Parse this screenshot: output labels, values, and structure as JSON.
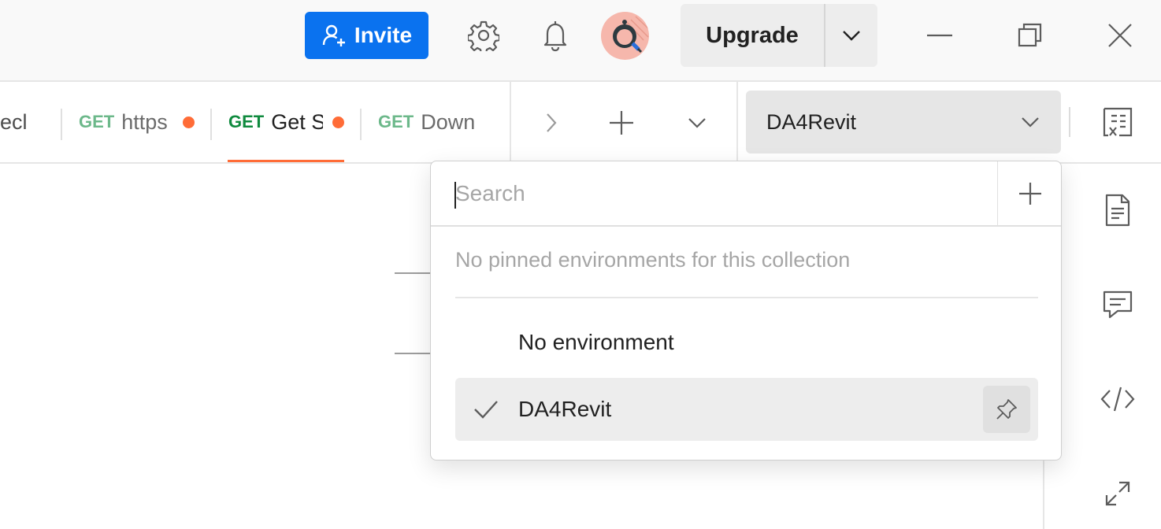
{
  "titlebar": {
    "invite_label": "Invite",
    "upgrade_label": "Upgrade",
    "accent_color": "#0a72ef"
  },
  "tabs": [
    {
      "method": "",
      "title": "ecl",
      "unsaved": false,
      "active": false
    },
    {
      "method": "GET",
      "title": "https",
      "unsaved": true,
      "active": false
    },
    {
      "method": "GET",
      "title": "Get S",
      "unsaved": true,
      "active": true
    },
    {
      "method": "GET",
      "title": "Down",
      "unsaved": false,
      "active": false
    }
  ],
  "environment": {
    "selected": "DA4Revit"
  },
  "env_dropdown": {
    "search_placeholder": "Search",
    "empty_pinned": "No pinned environments for this collection",
    "items": [
      {
        "label": "No environment",
        "selected": false
      },
      {
        "label": "DA4Revit",
        "selected": true
      }
    ]
  },
  "colors": {
    "get_method": "#0f8a3e",
    "get_method_muted": "#6cb88a",
    "unsaved_dot": "#ff6c37",
    "active_tab_underline": "#ff6c37"
  },
  "icons": {
    "titlebar": [
      "invite-user-icon",
      "settings-gear-icon",
      "notifications-bell-icon",
      "upgrade-chevron-down-icon",
      "minimize-icon",
      "restore-icon",
      "close-icon"
    ],
    "tabbar": [
      "tabs-scroll-right-icon",
      "new-tab-plus-icon",
      "tabs-menu-chevron-icon",
      "environment-chevron-down-icon",
      "environment-quick-look-icon"
    ],
    "sidebar": [
      "documentation-icon",
      "comments-icon",
      "code-snippet-icon",
      "expand-icon"
    ]
  }
}
